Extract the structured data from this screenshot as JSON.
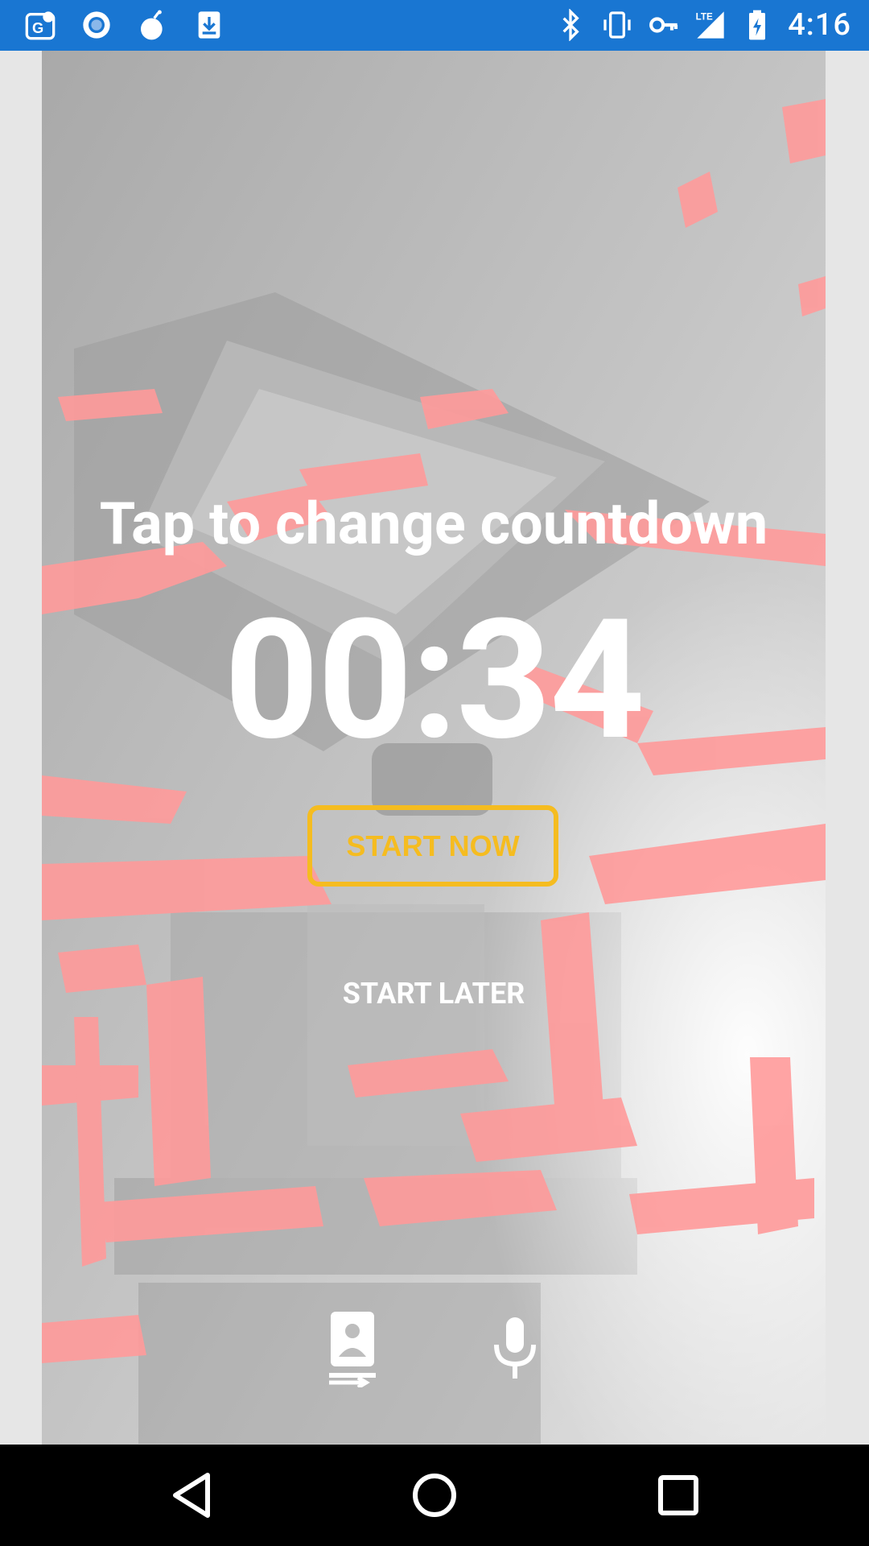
{
  "status_bar": {
    "time": "4:16",
    "network": "LTE",
    "bg_color": "#1976d2",
    "left_icons": [
      "maps-icon",
      "circle-app-icon",
      "bomb-icon",
      "download-icon"
    ],
    "right_icons": [
      "bluetooth-icon",
      "vibrate-icon",
      "vpn-key-icon",
      "signal-icon",
      "battery-charging-icon"
    ]
  },
  "countdown": {
    "hint": "Tap to change countdown",
    "time": "00:34"
  },
  "actions": {
    "start_now": "START NOW",
    "start_later": "START LATER"
  },
  "colors": {
    "accent": "#f5bc20",
    "overlay_red": "#ff9a9a"
  },
  "bottom_icons": [
    "switch-camera-icon",
    "microphone-icon"
  ],
  "nav_bar": [
    "back-icon",
    "home-icon",
    "recents-icon"
  ]
}
